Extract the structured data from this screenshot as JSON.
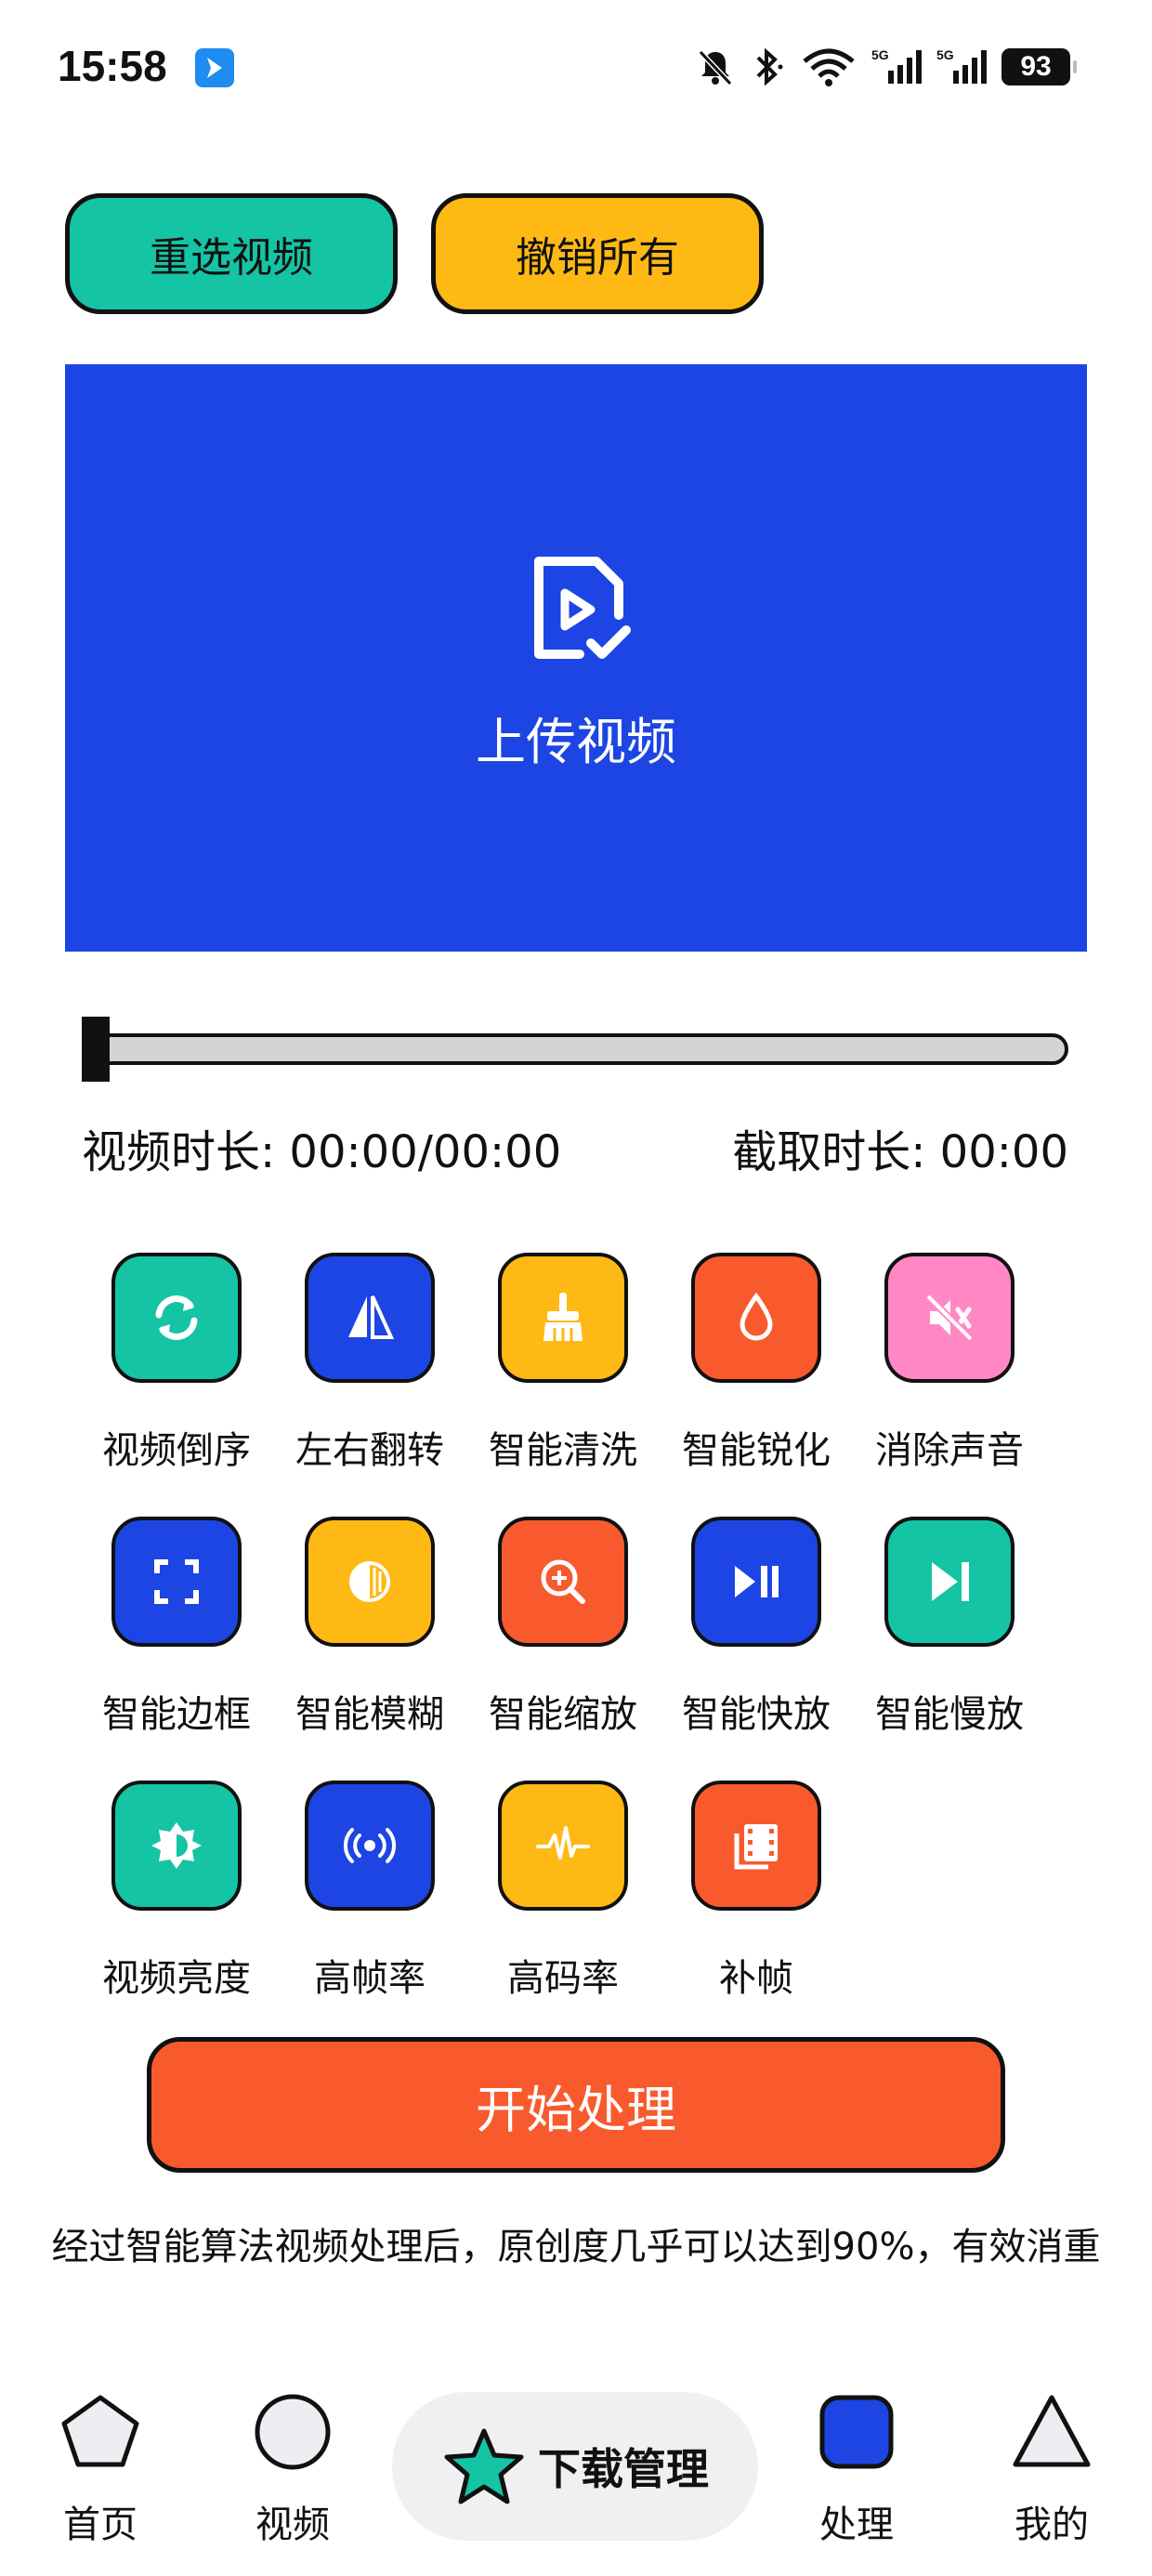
{
  "status_bar": {
    "time": "15:58",
    "battery": "93",
    "signal1_label": "5G",
    "signal2_label": "5G"
  },
  "top_buttons": {
    "reselect_label": "重选视频",
    "undo_label": "撤销所有"
  },
  "upload": {
    "label": "上传视频"
  },
  "slider": {
    "progress": 0
  },
  "duration": {
    "video_label": "视频时长: 00:00/00:00",
    "clip_label": "截取时长: 00:00"
  },
  "tools": [
    {
      "label": "视频倒序",
      "icon": "refresh-icon",
      "color": "#14c4a4"
    },
    {
      "label": "左右翻转",
      "icon": "flip-icon",
      "color": "#1c45e4"
    },
    {
      "label": "智能清洗",
      "icon": "broom-icon",
      "color": "#ffb914"
    },
    {
      "label": "智能锐化",
      "icon": "drop-icon",
      "color": "#f85a2e"
    },
    {
      "label": "消除声音",
      "icon": "mute-icon",
      "color": "#ff88c4"
    },
    {
      "label": "智能边框",
      "icon": "frame-icon",
      "color": "#1c45e4"
    },
    {
      "label": "智能模糊",
      "icon": "blur-icon",
      "color": "#ffb914"
    },
    {
      "label": "智能缩放",
      "icon": "zoom-icon",
      "color": "#f85a2e"
    },
    {
      "label": "智能快放",
      "icon": "play-pause-icon",
      "color": "#1c45e4"
    },
    {
      "label": "智能慢放",
      "icon": "skip-icon",
      "color": "#14c4a4"
    },
    {
      "label": "视频亮度",
      "icon": "brightness-icon",
      "color": "#14c4a4"
    },
    {
      "label": "高帧率",
      "icon": "broadcast-icon",
      "color": "#1c45e4"
    },
    {
      "label": "高码率",
      "icon": "pulse-icon",
      "color": "#ffb914"
    },
    {
      "label": "补帧",
      "icon": "film-icon",
      "color": "#f85a2e"
    }
  ],
  "start_button": {
    "label": "开始处理"
  },
  "description": "经过智能算法视频处理后，原创度几乎可以达到90%，有效消重",
  "bottom_nav": {
    "home": "首页",
    "video": "视频",
    "download": "下载管理",
    "process": "处理",
    "mine": "我的"
  }
}
